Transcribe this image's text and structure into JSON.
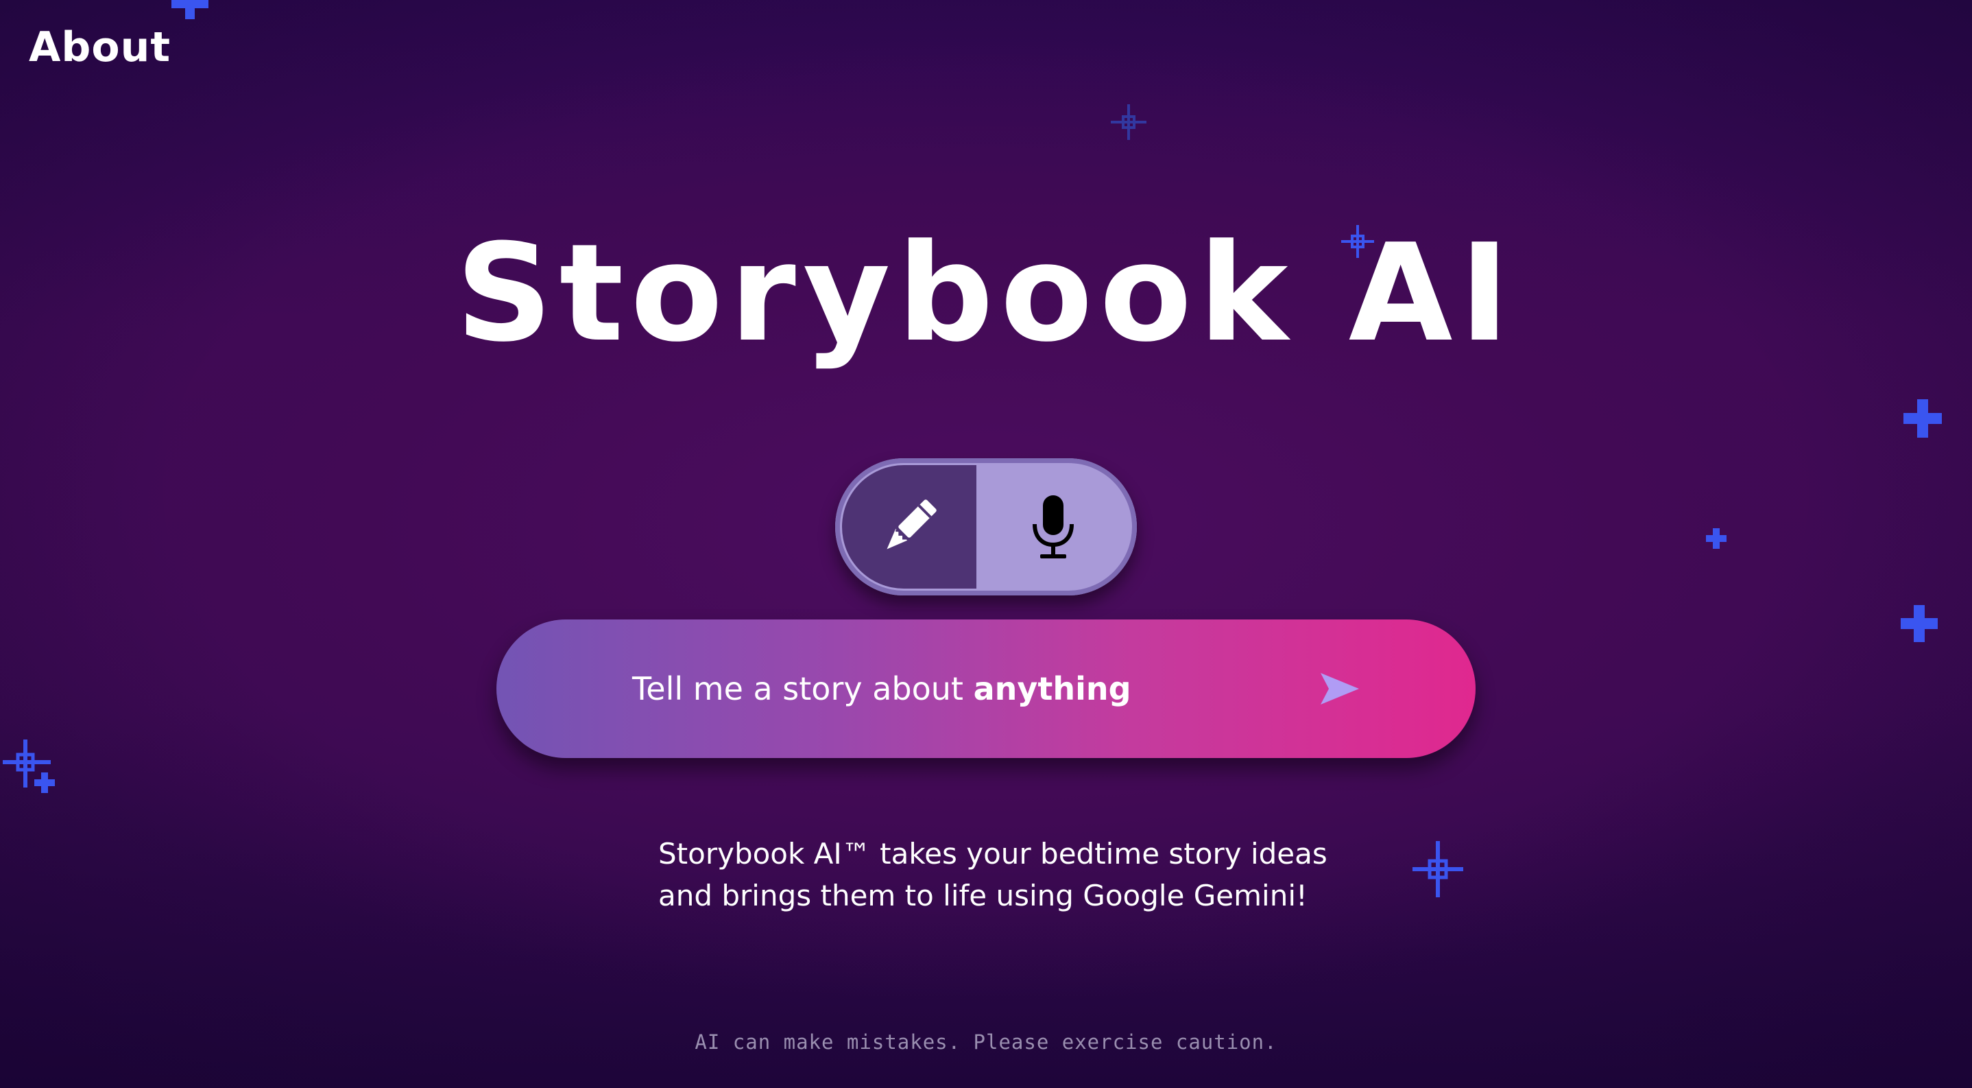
{
  "nav": {
    "about_label": "About"
  },
  "hero": {
    "title": "Storybook AI"
  },
  "mode_toggle": {
    "options": [
      {
        "icon": "pencil-icon",
        "selected": true
      },
      {
        "icon": "microphone-icon",
        "selected": false
      }
    ]
  },
  "prompt": {
    "text_prefix": "Tell me a story about ",
    "text_emphasis": "anything",
    "send_icon": "send-arrow-icon"
  },
  "description": {
    "line1": "Storybook AI™ takes your bedtime story ideas",
    "line2": "and brings them to life using Google Gemini!"
  },
  "footer": {
    "disclaimer": "AI can make mistakes. Please exercise caution."
  },
  "colors": {
    "background_dark": "#2e0850",
    "background_mid": "#4c0d5f",
    "prompt_gradient_start": "#7354b4",
    "prompt_gradient_end": "#e0288f",
    "toggle_bg": "#a99ad8",
    "toggle_selected": "#4e3374",
    "send_arrow": "#b09cf5",
    "sparkle": "#3a55f0"
  },
  "decorations": {
    "icon": "sparkle-icon"
  }
}
